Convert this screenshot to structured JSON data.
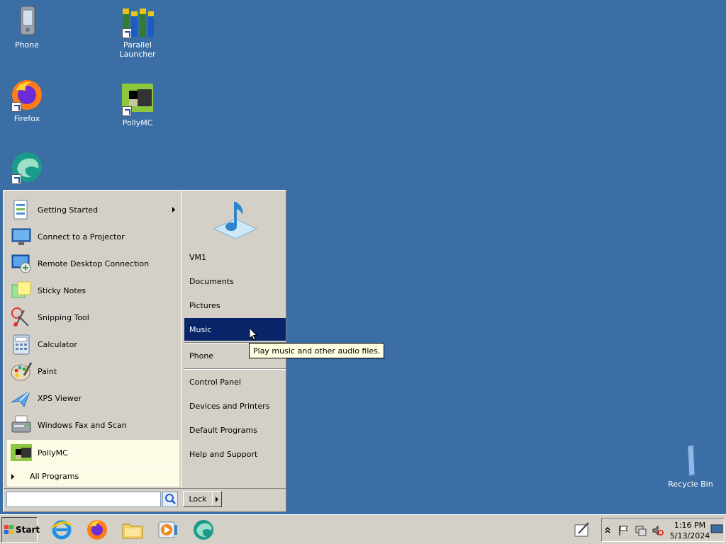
{
  "desktop": {
    "icons": [
      {
        "label": "Phone"
      },
      {
        "label": "Parallel Launcher"
      },
      {
        "label": "Firefox"
      },
      {
        "label": "PollyMC"
      },
      {
        "label": ""
      },
      {
        "label": "Recycle Bin"
      }
    ]
  },
  "start_menu": {
    "programs": [
      {
        "label": "Getting Started",
        "icon": "getting-started-icon"
      },
      {
        "label": "Connect to a Projector",
        "icon": "projector-icon"
      },
      {
        "label": "Remote Desktop Connection",
        "icon": "remote-desktop-icon"
      },
      {
        "label": "Sticky Notes",
        "icon": "sticky-notes-icon"
      },
      {
        "label": "Snipping Tool",
        "icon": "scissors-icon"
      },
      {
        "label": "Calculator",
        "icon": "calculator-icon"
      },
      {
        "label": "Paint",
        "icon": "paint-palette-icon"
      },
      {
        "label": "XPS Viewer",
        "icon": "xps-viewer-icon"
      },
      {
        "label": "Windows Fax and Scan",
        "icon": "fax-icon"
      },
      {
        "label": "PollyMC",
        "icon": "pollymc-icon"
      }
    ],
    "all_programs": "All Programs",
    "right_items": [
      {
        "label": "VM1"
      },
      {
        "label": "Documents"
      },
      {
        "label": "Pictures"
      },
      {
        "label": "Music"
      },
      {
        "label": "Phone"
      },
      {
        "label": "Control Panel"
      },
      {
        "label": "Devices and Printers"
      },
      {
        "label": "Default Programs"
      },
      {
        "label": "Help and Support"
      }
    ],
    "search_value": "",
    "lock_label": "Lock"
  },
  "tooltip": "Play music and other audio files.",
  "taskbar": {
    "start_label": "Start",
    "pinned": [
      "internet-explorer-icon",
      "firefox-icon",
      "explorer-folder-icon",
      "media-player-icon",
      "edge-icon"
    ]
  },
  "tray": {
    "time": "1:16 PM",
    "date": "5/13/2024"
  },
  "colors": {
    "desktop": "#3a6ea5",
    "menu_face": "#d4d0c8",
    "highlight": "#0a246a",
    "pinned_bg": "#fbfbe6",
    "tooltip_bg": "#ffffe1"
  }
}
